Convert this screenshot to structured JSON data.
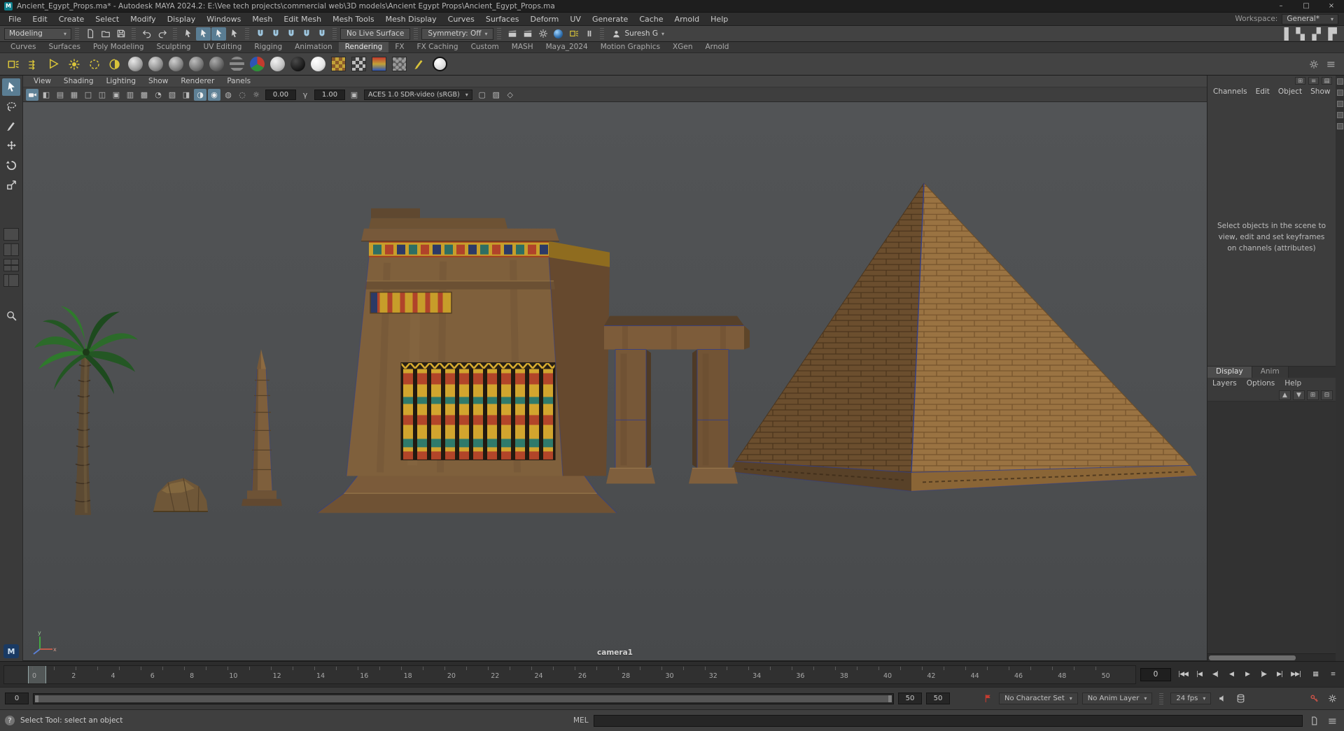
{
  "titlebar": {
    "title": "Ancient_Egypt_Props.ma* - Autodesk MAYA 2024.2: E:\\Vee tech projects\\commercial web\\3D models\\Ancient Egypt Props\\Ancient_Egypt_Props.ma"
  },
  "menubar": {
    "items": [
      "File",
      "Edit",
      "Create",
      "Select",
      "Modify",
      "Display",
      "Windows",
      "Mesh",
      "Edit Mesh",
      "Mesh Tools",
      "Mesh Display",
      "Curves",
      "Surfaces",
      "Deform",
      "UV",
      "Generate",
      "Cache",
      "Arnold",
      "Help"
    ],
    "workspace_label": "Workspace:",
    "workspace_value": "General*"
  },
  "statusline": {
    "menuset": "Modeling",
    "no_live_surface": "No Live Surface",
    "symmetry": "Symmetry: Off",
    "user": "Suresh G"
  },
  "shelf": {
    "tabs": [
      "Curves",
      "Surfaces",
      "Poly Modeling",
      "Sculpting",
      "UV Editing",
      "Rigging",
      "Animation",
      "Rendering",
      "FX",
      "FX Caching",
      "Custom",
      "MASH",
      "Maya_2024",
      "Motion Graphics",
      "XGen",
      "Arnold"
    ],
    "active_tab": "Rendering"
  },
  "panel_menus": [
    "View",
    "Shading",
    "Lighting",
    "Show",
    "Renderer",
    "Panels"
  ],
  "viewport": {
    "exposure": "0.00",
    "gamma": "1.00",
    "colorspace": "ACES 1.0 SDR-video (sRGB)",
    "camera": "camera1"
  },
  "channel_box": {
    "menus": [
      "Channels",
      "Edit",
      "Object",
      "Show"
    ],
    "message": "Select objects in the scene to view, edit and set keyframes on channels (attributes)"
  },
  "layer_editor": {
    "tabs": [
      "Display",
      "Anim"
    ],
    "menus": [
      "Layers",
      "Options",
      "Help"
    ]
  },
  "timeline": {
    "ticks": [
      "0",
      "2",
      "4",
      "6",
      "8",
      "10",
      "12",
      "14",
      "16",
      "18",
      "20",
      "22",
      "24",
      "26",
      "28",
      "30",
      "32",
      "34",
      "36",
      "38",
      "40",
      "42",
      "44",
      "46",
      "48",
      "50"
    ],
    "current_frame": "0"
  },
  "range": {
    "start": "0",
    "playback_end": "50",
    "anim_end": "50",
    "character_set": "No Character Set",
    "anim_layer": "No Anim Layer",
    "fps": "24 fps"
  },
  "bottombar": {
    "help_text": "Select Tool: select an object",
    "mel_label": "MEL"
  },
  "scene": {
    "objects": [
      "palm-tree",
      "rock",
      "obelisk",
      "temple-pylon",
      "gate",
      "pyramid"
    ]
  },
  "colors": {
    "accent": "#5a7d93",
    "viewport_bg": "#4e5052",
    "autokey_red": "#cf5348",
    "light_yellow": "#d8c33a"
  },
  "icons": {
    "window": [
      "minimize-icon",
      "maximize-icon",
      "close-icon"
    ],
    "statusline": [
      "new-scene",
      "open-scene",
      "save-scene",
      "undo",
      "redo",
      "select-hierarchy",
      "select-object",
      "select-component",
      "snap-grid",
      "snap-curve",
      "snap-point",
      "snap-plane",
      "snap-view",
      "render-frame",
      "ipr-render",
      "render-settings",
      "hypershade",
      "light-editor",
      "pause-viewport",
      "user-account",
      "attribute-editor-toggle",
      "tool-settings-toggle",
      "channel-box-toggle",
      "modeling-toolkit-toggle"
    ],
    "shelf_rendering": [
      "area-light",
      "directional-light",
      "spot-light",
      "point-light",
      "volume-light",
      "ambient-light",
      "standard-surface",
      "anisotropic",
      "blinn",
      "lambert",
      "phong",
      "ramp-shader",
      "surface-shader-rgb",
      "layered-shader",
      "black-shader",
      "white-shader",
      "checker-color",
      "checker-bw",
      "ramp-texture",
      "noise-texture",
      "paint-effects",
      "toon-shader"
    ],
    "toolbox": [
      "select-tool",
      "lasso-tool",
      "paint-select-tool",
      "move-tool",
      "rotate-tool",
      "scale-tool",
      "layout-single",
      "layout-two",
      "layout-four",
      "layout-split",
      "zoom-tool"
    ]
  }
}
